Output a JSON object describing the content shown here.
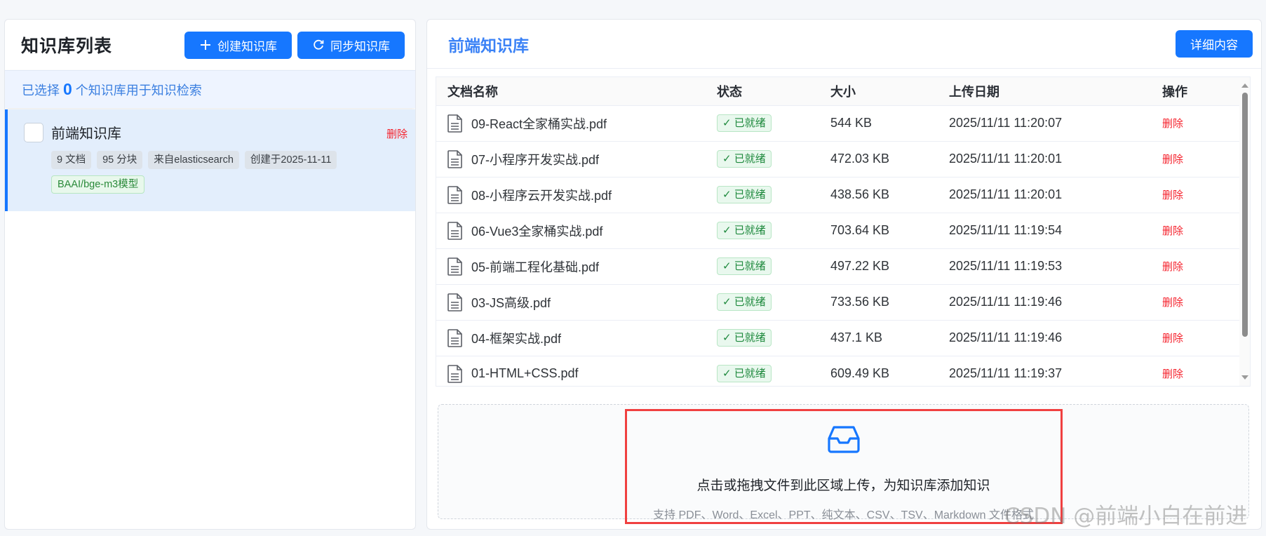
{
  "left": {
    "title": "知识库列表",
    "create_button": "创建知识库",
    "sync_button": "同步知识库",
    "selection_prefix": "已选择",
    "selection_count": "0",
    "selection_suffix": "个知识库用于知识检索",
    "kb_item": {
      "name": "前端知识库",
      "delete_label": "删除",
      "tags": [
        "9 文档",
        "95 分块",
        "来自elasticsearch",
        "创建于2025-11-11"
      ],
      "model_tag": "BAAI/bge-m3模型"
    }
  },
  "right": {
    "title": "前端知识库",
    "detail_button": "详细内容",
    "table": {
      "headers": {
        "name": "文档名称",
        "status": "状态",
        "size": "大小",
        "date": "上传日期",
        "op": "操作"
      },
      "rows": [
        {
          "name": "09-React全家桶实战.pdf",
          "status": "✓ 已就绪",
          "size": "544 KB",
          "date": "2025/11/11 11:20:07",
          "op": "删除"
        },
        {
          "name": "07-小程序开发实战.pdf",
          "status": "✓ 已就绪",
          "size": "472.03 KB",
          "date": "2025/11/11 11:20:01",
          "op": "删除"
        },
        {
          "name": "08-小程序云开发实战.pdf",
          "status": "✓ 已就绪",
          "size": "438.56 KB",
          "date": "2025/11/11 11:20:01",
          "op": "删除"
        },
        {
          "name": "06-Vue3全家桶实战.pdf",
          "status": "✓ 已就绪",
          "size": "703.64 KB",
          "date": "2025/11/11 11:19:54",
          "op": "删除"
        },
        {
          "name": "05-前端工程化基础.pdf",
          "status": "✓ 已就绪",
          "size": "497.22 KB",
          "date": "2025/11/11 11:19:53",
          "op": "删除"
        },
        {
          "name": "03-JS高级.pdf",
          "status": "✓ 已就绪",
          "size": "733.56 KB",
          "date": "2025/11/11 11:19:46",
          "op": "删除"
        },
        {
          "name": "04-框架实战.pdf",
          "status": "✓ 已就绪",
          "size": "437.1 KB",
          "date": "2025/11/11 11:19:46",
          "op": "删除"
        },
        {
          "name": "01-HTML+CSS.pdf",
          "status": "✓ 已就绪",
          "size": "609.49 KB",
          "date": "2025/11/11 11:19:37",
          "op": "删除"
        }
      ]
    },
    "upload": {
      "icon": "inbox-icon",
      "title": "点击或拖拽文件到此区域上传，为知识库添加知识",
      "hint": "支持 PDF、Word、Excel、PPT、纯文本、CSV、TSV、Markdown 文件格式"
    }
  },
  "watermark": "CSDN @前端小白在前进",
  "colors": {
    "primary": "#1677ff",
    "danger": "#f5222d",
    "success": "#1f8a3e",
    "highlight": "#f04040"
  }
}
